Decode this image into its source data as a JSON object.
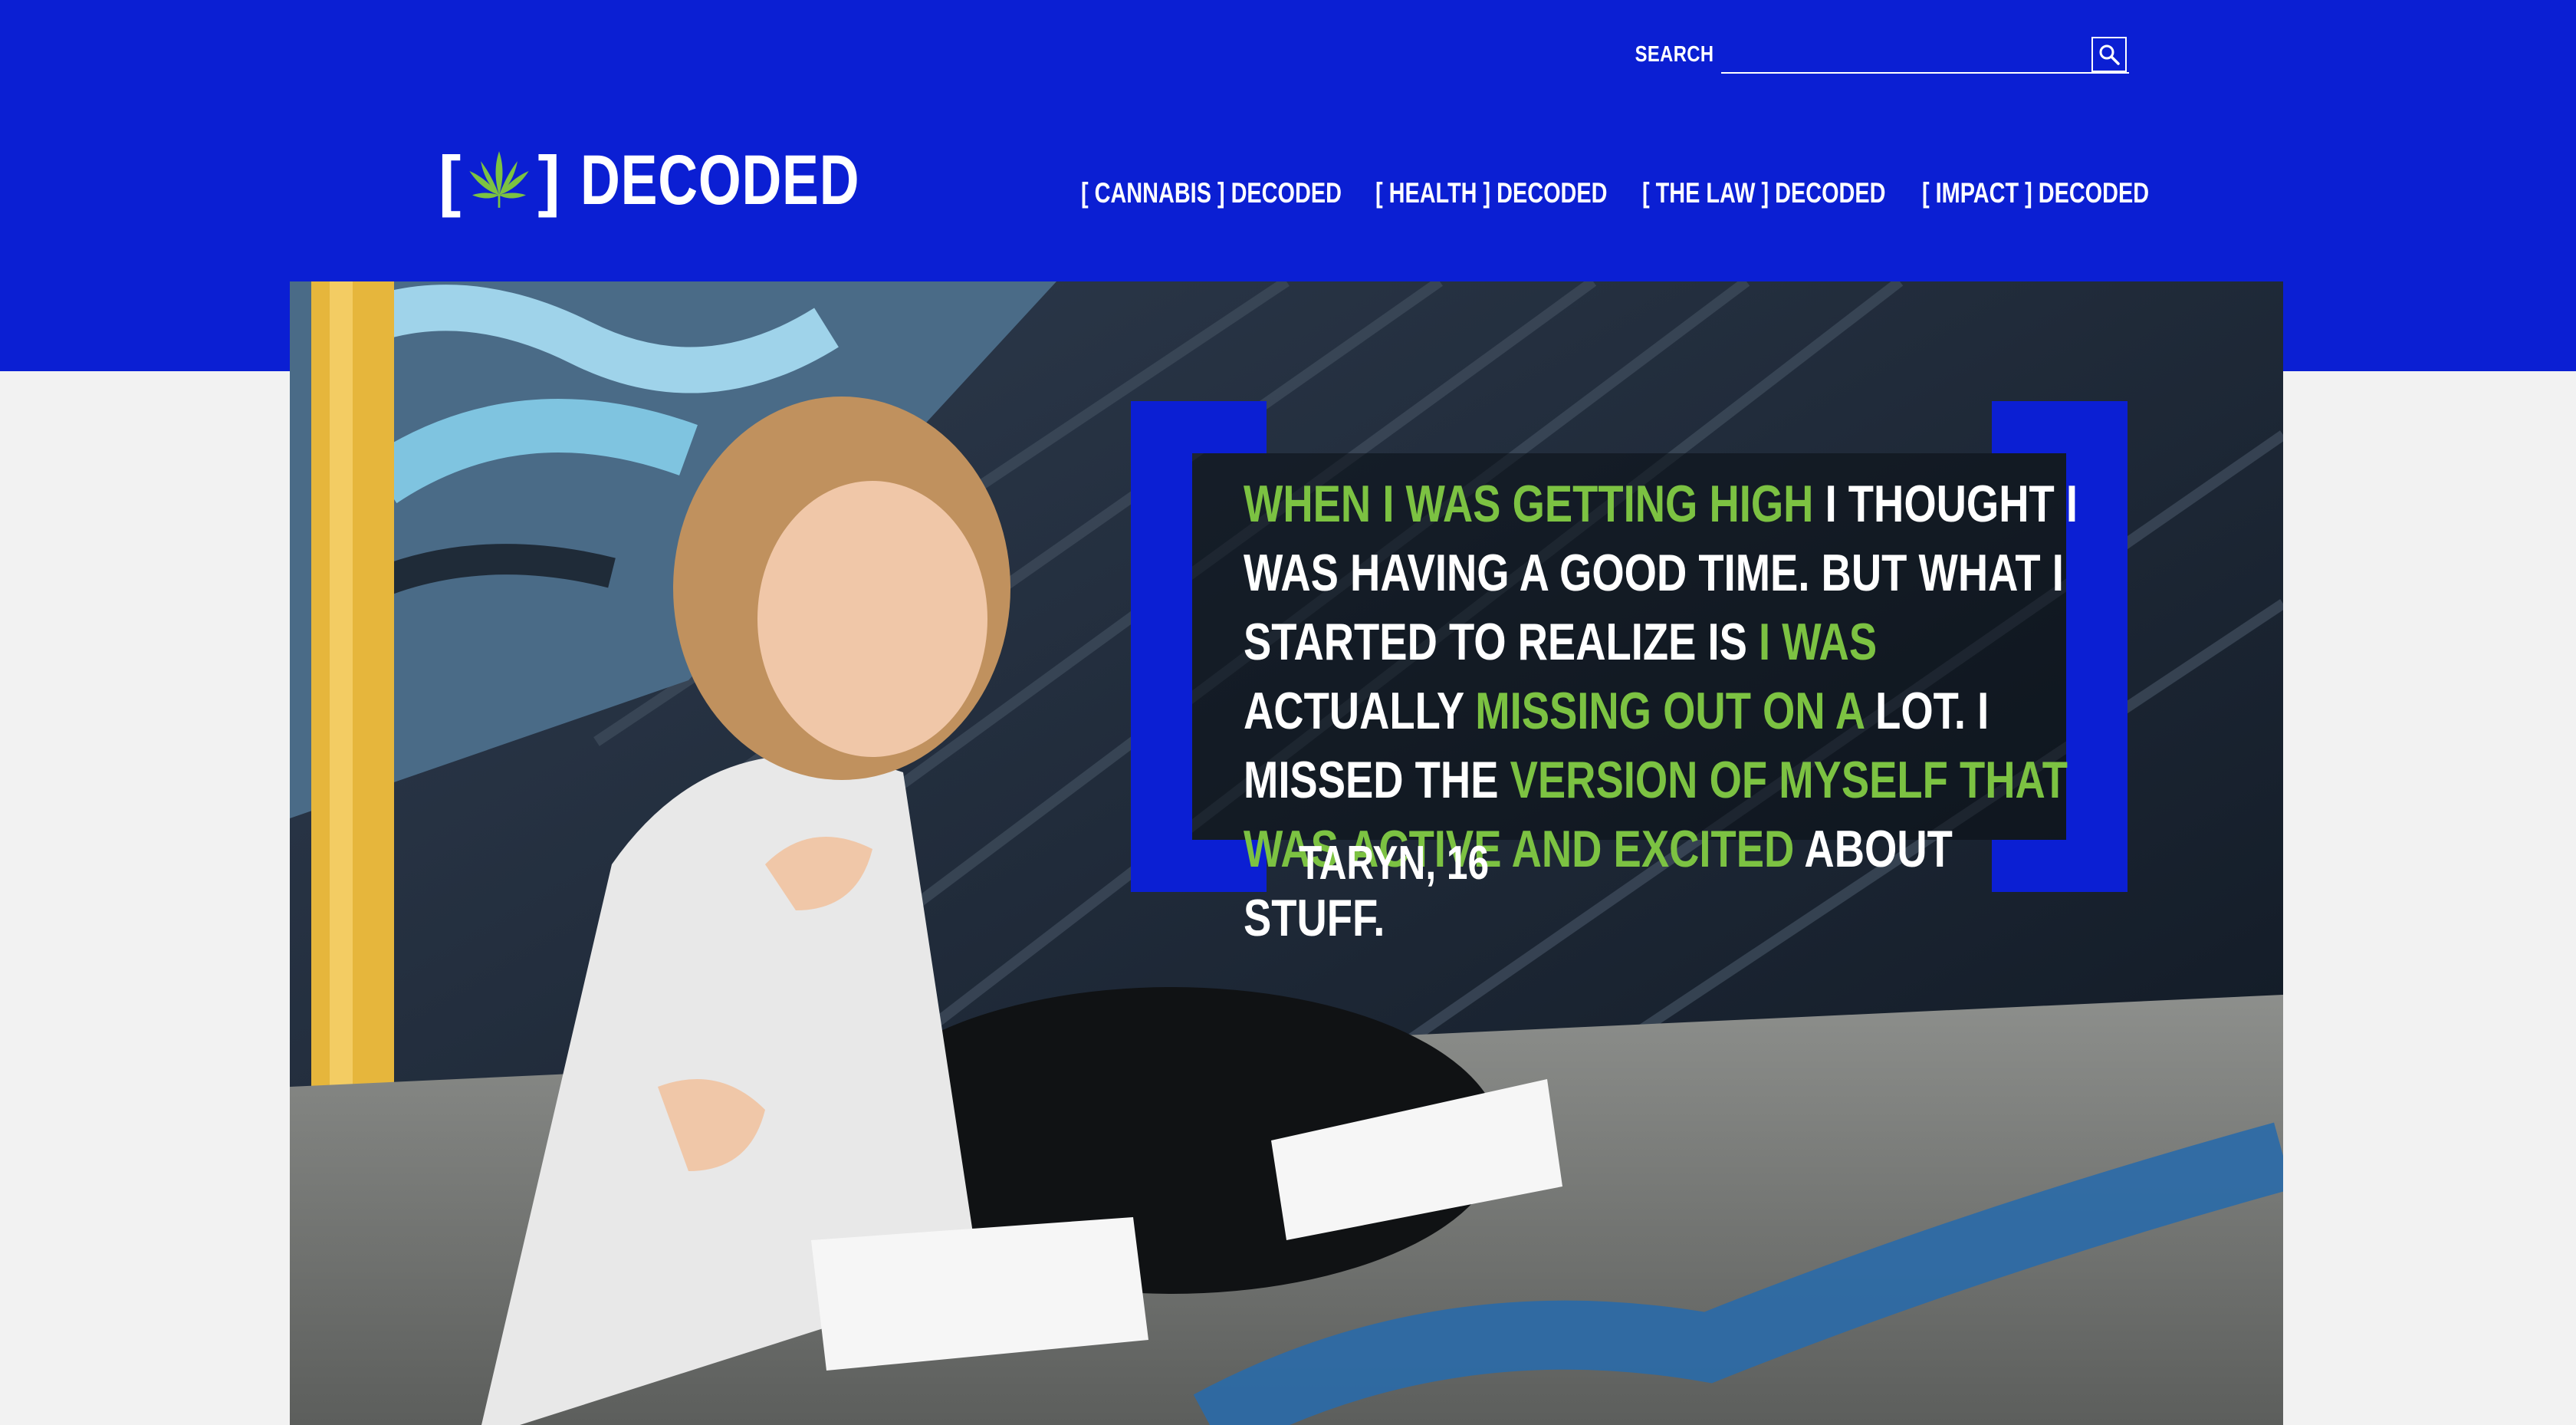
{
  "search": {
    "label": "SEARCH",
    "placeholder": "",
    "value": "",
    "icon": "search-icon"
  },
  "logo": {
    "bracket_open": "[",
    "bracket_close": "]",
    "word": "DECODED",
    "icon": "cannabis-leaf-icon"
  },
  "nav": {
    "items": [
      {
        "label": "[ CANNABIS ] DECODED"
      },
      {
        "label": "[ HEALTH ] DECODED"
      },
      {
        "label": "[ THE LAW ] DECODED"
      },
      {
        "label": "[ IMPACT ] DECODED"
      }
    ]
  },
  "hero": {
    "quote": {
      "parts": [
        {
          "text": "WHEN I WAS GETTING HIGH",
          "highlight": true
        },
        {
          "text": " I THOUGHT I WAS HAVING A GOOD TIME. BUT WHAT I STARTED TO REALIZE IS ",
          "highlight": false
        },
        {
          "text": "I WAS",
          "highlight": true
        },
        {
          "text": " ACTUALLY ",
          "highlight": false
        },
        {
          "text": "MISSING OUT ON A",
          "highlight": true
        },
        {
          "text": " LOT. I MISSED THE ",
          "highlight": false
        },
        {
          "text": "VERSION OF MYSELF THAT WAS ACTIVE AND EXCITED",
          "highlight": true
        },
        {
          "text": " ABOUT STUFF.",
          "highlight": false
        }
      ]
    },
    "author": "TARYN, 16"
  },
  "colors": {
    "brand_blue": "#0b1fd3",
    "highlight_green": "#7cc242",
    "page_bg": "#f2f2f2"
  }
}
